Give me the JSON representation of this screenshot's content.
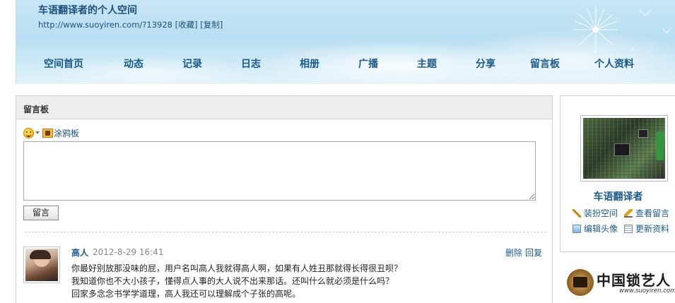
{
  "header": {
    "title": "车语翻译者的个人空间",
    "url": "http://www.suoyiren.com/?13928",
    "favorite_label": "[收藏]",
    "copy_label": "[复制]"
  },
  "nav": [
    {
      "label": "空间首页"
    },
    {
      "label": "动态"
    },
    {
      "label": "记录"
    },
    {
      "label": "日志"
    },
    {
      "label": "相册"
    },
    {
      "label": "广播"
    },
    {
      "label": "主题"
    },
    {
      "label": "分享"
    },
    {
      "label": "留言板"
    },
    {
      "label": "个人资料"
    }
  ],
  "guestbook": {
    "title": "留言板",
    "toolbar": {
      "emoji_icon": "smiley-icon",
      "graffiti_icon": "graffiti-board-icon",
      "graffiti_label": "涂鸦板"
    },
    "message_value": "",
    "submit_label": "留言"
  },
  "entry": {
    "author": "高人",
    "time": "2012-8-29 16:41",
    "delete_label": "删除",
    "reply_label": "回复",
    "lines": [
      "你最好别放那没味的屁，用户名叫高人我就得高人啊，如果有人姓丑那就得长得很丑呗？",
      "我知道你也不大小孩子，懂得点人事的大人说不出来那话。还叫什么就必须是什么吗？",
      "回家多念念书学学道理，高人我还可以理解成个子张的高呢。"
    ]
  },
  "sidebar": {
    "name": "车语翻译者",
    "links": [
      {
        "label": "装扮空间",
        "icon": "dress-up-icon"
      },
      {
        "label": "查看留言",
        "icon": "pencil-icon"
      },
      {
        "label": "编辑头像",
        "icon": "photo-icon"
      },
      {
        "label": "更新资料",
        "icon": "profile-card-icon"
      }
    ]
  },
  "watermark": {
    "logo_text": "中国锁艺人",
    "url": "www.suoyiren.com"
  }
}
